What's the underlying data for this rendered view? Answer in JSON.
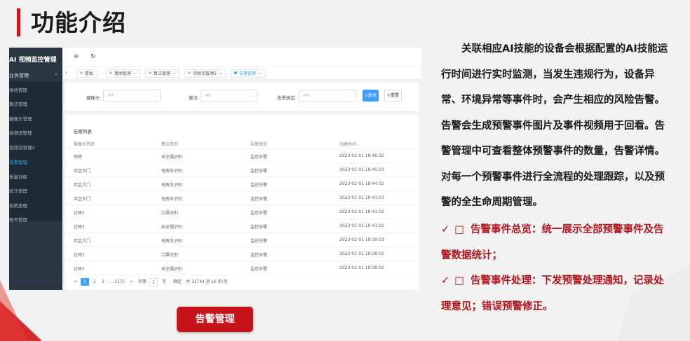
{
  "slide": {
    "title": "功能介绍",
    "caption": "告警管理",
    "description": "关联相应AI技能的设备会根据配置的AI技能运行时间进行实时监测，当发生违规行为，设备异常、环境异常等事件时，会产生相应的风险告警。告警会生成预警事件图片及事件视频用于回看。告警管理中可查看整体预警事件的数量，告警详情。对每一个预警事件进行全流程的处理跟踪，以及预警的全生命周期管理。",
    "bullets": [
      {
        "check": "✓",
        "box": "□",
        "text": "告警事件总览：统一展示全部预警事件及告警数据统计；"
      },
      {
        "check": "✓",
        "box": "□",
        "text": "告警事件处理：下发预警处理通知，记录处理意见；错误预警修正。"
      }
    ],
    "accent_color": "#d0141b"
  },
  "app": {
    "title": "AI 视频监控管理",
    "sidebar": {
      "group": "业务管理",
      "group_icon": "chevron-up-icon",
      "items": [
        {
          "label": "场地管理",
          "active": false
        },
        {
          "label": "算法管理",
          "active": false
        },
        {
          "label": "摄像头管理",
          "active": false
        },
        {
          "label": "视频流管理",
          "active": false
        },
        {
          "label": "视频流管理2",
          "active": false
        },
        {
          "label": "告警管理",
          "active": true
        },
        {
          "label": "质量训练",
          "active": false
        },
        {
          "label": "统计管理",
          "active": false
        },
        {
          "label": "系统管理",
          "active": false
        },
        {
          "label": "账号管理",
          "active": false
        }
      ]
    },
    "topbar": {
      "menu_icon": "≡",
      "refresh_icon": "↻"
    },
    "tabs": [
      {
        "label": "看板",
        "active": false
      },
      {
        "label": "基地管理",
        "active": false
      },
      {
        "label": "算法管理",
        "active": false
      },
      {
        "label": "视频流管理2",
        "active": false
      },
      {
        "label": "告警管理",
        "active": true
      }
    ],
    "filter": {
      "camera_label": "摄像头",
      "camera_placeholder": "-All-",
      "algo_label": "算法",
      "algo_placeholder": "-All-",
      "type_label": "告警类型",
      "type_placeholder": "-All-",
      "search_label": "查询",
      "reset_label": "重置"
    },
    "table": {
      "title": "告警列表",
      "columns": [
        "摄像头名称",
        "算法名称",
        "告警类型",
        "创建时间"
      ],
      "rows": [
        [
          "地磅",
          "安全帽识别",
          "监控告警",
          "2023-02-01 18:46:02"
        ],
        [
          "库区大门",
          "电瓶车识别",
          "监控告警",
          "2023-02-01 18:45:03"
        ],
        [
          "库区大门",
          "电瓶车识别",
          "监控告警",
          "2023-02-01 18:44:02"
        ],
        [
          "库区大门",
          "电瓶车识别",
          "监控告警",
          "2023-02-01 18:41:03"
        ],
        [
          "过磅3",
          "口罩识别",
          "监控告警",
          "2023-02-01 18:41:02"
        ],
        [
          "过磅3",
          "安全帽识别",
          "监控告警",
          "2023-02-01 18:41:02"
        ],
        [
          "库区大门",
          "电瓶车识别",
          "监控告警",
          "2023-02-01 18:39:03"
        ],
        [
          "过磅3",
          "口罩识别",
          "监控告警",
          "2023-02-01 18:38:02"
        ],
        [
          "过磅3",
          "安全帽识别",
          "监控告警",
          "2023-02-01 18:38:02"
        ]
      ]
    },
    "pagination": {
      "prev": "<",
      "pages": [
        "1",
        "2",
        "3",
        "...",
        "3175"
      ],
      "next": ">",
      "goto_label": "到第",
      "goto_value": "1",
      "page_unit": "页",
      "confirm": "确定",
      "total": "共 31744 条",
      "page_size": "10 条/页"
    }
  }
}
